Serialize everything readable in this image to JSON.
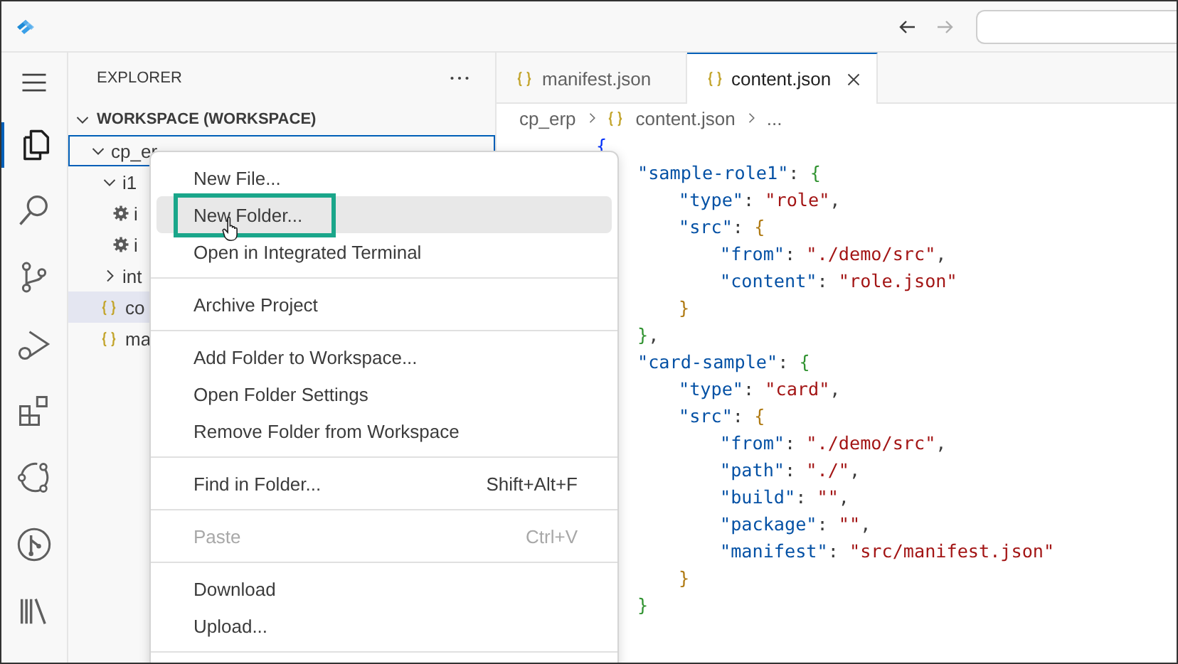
{
  "sidebar": {
    "title": "EXPLORER",
    "section": {
      "label": "WORKSPACE (WORKSPACE)",
      "expanded": true
    },
    "tree": [
      {
        "kind": "folder",
        "label": "cp_er",
        "expanded": true,
        "selected": false,
        "focused": true,
        "children": [
          {
            "kind": "folder",
            "label": "i1",
            "expanded": true,
            "selected": false,
            "focused": false,
            "children": [
              {
                "kind": "settings",
                "label": "i",
                "selected": false,
                "focused": false
              },
              {
                "kind": "settings",
                "label": "i",
                "selected": false,
                "focused": false
              }
            ]
          },
          {
            "kind": "folder",
            "label": "int",
            "expanded": false,
            "selected": false,
            "focused": false
          },
          {
            "kind": "json",
            "label": "co",
            "selected": true,
            "focused": false
          },
          {
            "kind": "json",
            "label": "ma",
            "selected": false,
            "focused": false
          }
        ]
      }
    ]
  },
  "tabs": [
    {
      "label": "manifest.json",
      "selected": false
    },
    {
      "label": "content.json",
      "selected": true
    }
  ],
  "breadcrumb": [
    {
      "kind": "folder",
      "label": "cp_erp"
    },
    {
      "kind": "json",
      "label": "content.json"
    },
    {
      "kind": "more",
      "label": "..."
    }
  ],
  "code": [
    {
      "tokens": [
        {
          "kind": "brace1",
          "text": "{"
        }
      ],
      "children": [
        {
          "tokens": [
            {
              "kind": "key",
              "text": "\"sample-role1\""
            },
            {
              "kind": "punct",
              "text": ": "
            },
            {
              "kind": "brace2",
              "text": "{"
            }
          ],
          "children": [
            {
              "tokens": [
                {
                  "kind": "key",
                  "text": "\"type\""
                },
                {
                  "kind": "punct",
                  "text": ": "
                },
                {
                  "kind": "string",
                  "text": "\"role\""
                },
                {
                  "kind": "punct",
                  "text": ","
                }
              ]
            },
            {
              "tokens": [
                {
                  "kind": "key",
                  "text": "\"src\""
                },
                {
                  "kind": "punct",
                  "text": ": "
                },
                {
                  "kind": "brace3",
                  "text": "{"
                }
              ],
              "children": [
                {
                  "tokens": [
                    {
                      "kind": "key",
                      "text": "\"from\""
                    },
                    {
                      "kind": "punct",
                      "text": ": "
                    },
                    {
                      "kind": "string",
                      "text": "\"./demo/src\""
                    },
                    {
                      "kind": "punct",
                      "text": ","
                    }
                  ]
                },
                {
                  "tokens": [
                    {
                      "kind": "key",
                      "text": "\"content\""
                    },
                    {
                      "kind": "punct",
                      "text": ": "
                    },
                    {
                      "kind": "string",
                      "text": "\"role.json\""
                    }
                  ]
                }
              ],
              "close": [
                {
                  "kind": "brace3",
                  "text": "}"
                }
              ]
            }
          ],
          "close": [
            {
              "kind": "brace2",
              "text": "}"
            },
            {
              "kind": "punct",
              "text": ","
            }
          ]
        },
        {
          "tokens": [
            {
              "kind": "key",
              "text": "\"card-sample\""
            },
            {
              "kind": "punct",
              "text": ": "
            },
            {
              "kind": "brace2",
              "text": "{"
            }
          ],
          "children": [
            {
              "tokens": [
                {
                  "kind": "key",
                  "text": "\"type\""
                },
                {
                  "kind": "punct",
                  "text": ": "
                },
                {
                  "kind": "string",
                  "text": "\"card\""
                },
                {
                  "kind": "punct",
                  "text": ","
                }
              ]
            },
            {
              "tokens": [
                {
                  "kind": "key",
                  "text": "\"src\""
                },
                {
                  "kind": "punct",
                  "text": ": "
                },
                {
                  "kind": "brace3",
                  "text": "{"
                }
              ],
              "children": [
                {
                  "tokens": [
                    {
                      "kind": "key",
                      "text": "\"from\""
                    },
                    {
                      "kind": "punct",
                      "text": ": "
                    },
                    {
                      "kind": "string",
                      "text": "\"./demo/src\""
                    },
                    {
                      "kind": "punct",
                      "text": ","
                    }
                  ]
                },
                {
                  "tokens": [
                    {
                      "kind": "key",
                      "text": "\"path\""
                    },
                    {
                      "kind": "punct",
                      "text": ": "
                    },
                    {
                      "kind": "string",
                      "text": "\"./\""
                    },
                    {
                      "kind": "punct",
                      "text": ","
                    }
                  ]
                },
                {
                  "tokens": [
                    {
                      "kind": "key",
                      "text": "\"build\""
                    },
                    {
                      "kind": "punct",
                      "text": ": "
                    },
                    {
                      "kind": "string",
                      "text": "\"\""
                    },
                    {
                      "kind": "punct",
                      "text": ","
                    }
                  ]
                },
                {
                  "tokens": [
                    {
                      "kind": "key",
                      "text": "\"package\""
                    },
                    {
                      "kind": "punct",
                      "text": ": "
                    },
                    {
                      "kind": "string",
                      "text": "\"\""
                    },
                    {
                      "kind": "punct",
                      "text": ","
                    }
                  ]
                },
                {
                  "tokens": [
                    {
                      "kind": "key",
                      "text": "\"manifest\""
                    },
                    {
                      "kind": "punct",
                      "text": ": "
                    },
                    {
                      "kind": "string",
                      "text": "\"src/manifest.json\""
                    }
                  ]
                }
              ],
              "close": [
                {
                  "kind": "brace3",
                  "text": "}"
                }
              ]
            }
          ],
          "close": [
            {
              "kind": "brace2",
              "text": "}"
            }
          ]
        }
      ]
    }
  ],
  "context_menu": [
    {
      "kind": "item",
      "label": "New File...",
      "selected": false,
      "disabled": false,
      "annotated": false
    },
    {
      "kind": "item",
      "label": "New Folder...",
      "selected": true,
      "disabled": false,
      "annotated": true
    },
    {
      "kind": "item",
      "label": "Open in Integrated Terminal",
      "selected": false,
      "disabled": false,
      "annotated": false
    },
    {
      "kind": "separator"
    },
    {
      "kind": "item",
      "label": "Archive Project",
      "selected": false,
      "disabled": false,
      "annotated": false
    },
    {
      "kind": "separator"
    },
    {
      "kind": "item",
      "label": "Add Folder to Workspace...",
      "selected": false,
      "disabled": false,
      "annotated": false
    },
    {
      "kind": "item",
      "label": "Open Folder Settings",
      "selected": false,
      "disabled": false,
      "annotated": false
    },
    {
      "kind": "item",
      "label": "Remove Folder from Workspace",
      "selected": false,
      "disabled": false,
      "annotated": false
    },
    {
      "kind": "separator"
    },
    {
      "kind": "item",
      "label": "Find in Folder...",
      "shortcut": "Shift+Alt+F",
      "selected": false,
      "disabled": false,
      "annotated": false
    },
    {
      "kind": "separator"
    },
    {
      "kind": "item",
      "label": "Paste",
      "shortcut": "Ctrl+V",
      "selected": false,
      "disabled": true,
      "annotated": false
    },
    {
      "kind": "separator"
    },
    {
      "kind": "item",
      "label": "Download",
      "selected": false,
      "disabled": false,
      "annotated": false
    },
    {
      "kind": "item",
      "label": "Upload...",
      "selected": false,
      "disabled": false,
      "annotated": false
    },
    {
      "kind": "separator"
    }
  ]
}
